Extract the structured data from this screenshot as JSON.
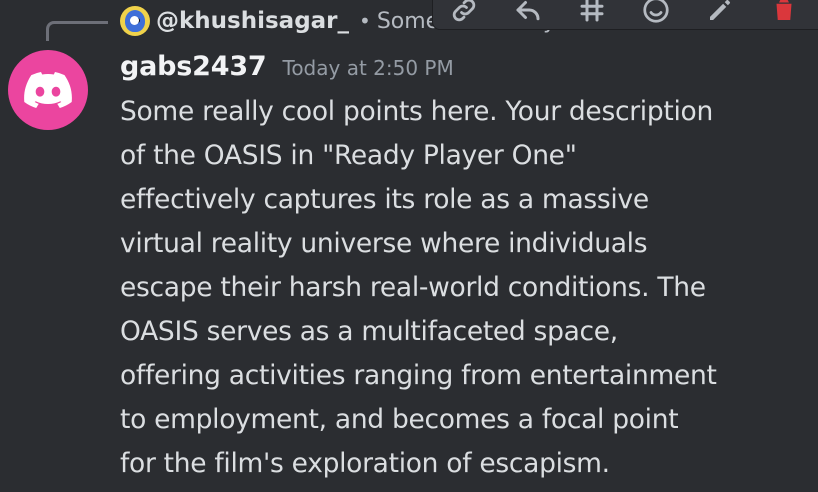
{
  "reply": {
    "username": "@khushisagar_",
    "separator": "•",
    "preview": "Some of the key features in \"Re..."
  },
  "toolbar": {
    "items": [
      {
        "icon": "link-icon"
      },
      {
        "icon": "reply-icon"
      },
      {
        "icon": "thread-icon"
      },
      {
        "icon": "emoji-icon"
      },
      {
        "icon": "edit-icon"
      },
      {
        "icon": "delete-icon",
        "color": "#da373c"
      }
    ]
  },
  "message": {
    "author": "gabs2437",
    "timestamp": "Today at 2:50 PM",
    "avatar_color": "#eb459f",
    "lines": [
      "Some really cool points here. Your description",
      "of the OASIS in \"Ready Player One\"",
      "effectively captures its role as a massive",
      "virtual reality universe where individuals",
      "escape their harsh real-world conditions. The",
      "OASIS serves as a multifaceted space,",
      "offering activities ranging from entertainment",
      "to employment, and becomes a focal point",
      "for the film's exploration of escapism."
    ]
  }
}
